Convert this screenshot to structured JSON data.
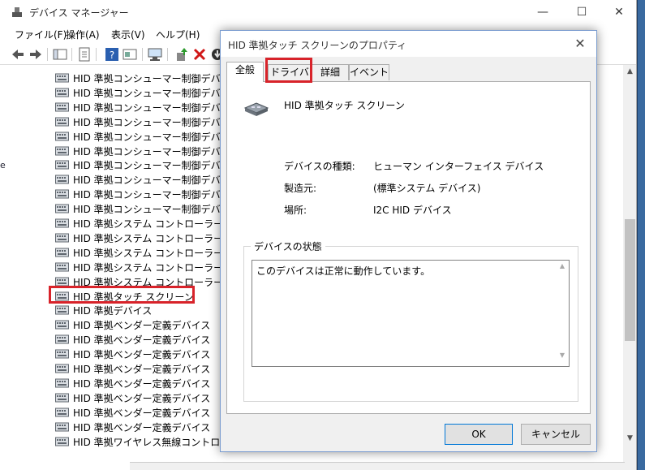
{
  "main_window": {
    "title": "デバイス マネージャー",
    "minimize_glyph": "—",
    "maximize_glyph": "☐",
    "close_glyph": "✕",
    "menu": [
      "ファイル(F)",
      "操作(A)",
      "表示(V)",
      "ヘルプ(H)"
    ],
    "left_edge_fragment": "e"
  },
  "device_tree": {
    "items": [
      "HID 準拠コンシューマー制御デバイス",
      "HID 準拠コンシューマー制御デバイス",
      "HID 準拠コンシューマー制御デバイス",
      "HID 準拠コンシューマー制御デバイス",
      "HID 準拠コンシューマー制御デバイス",
      "HID 準拠コンシューマー制御デバイス",
      "HID 準拠コンシューマー制御デバイス",
      "HID 準拠コンシューマー制御デバイス",
      "HID 準拠コンシューマー制御デバイス",
      "HID 準拠コンシューマー制御デバイス",
      "HID 準拠システム コントローラー",
      "HID 準拠システム コントローラー",
      "HID 準拠システム コントローラー",
      "HID 準拠システム コントローラー",
      "HID 準拠システム コントローラー",
      "HID 準拠タッチ スクリーン",
      "HID 準拠デバイス",
      "HID 準拠ベンダー定義デバイス",
      "HID 準拠ベンダー定義デバイス",
      "HID 準拠ベンダー定義デバイス",
      "HID 準拠ベンダー定義デバイス",
      "HID 準拠ベンダー定義デバイス",
      "HID 準拠ベンダー定義デバイス",
      "HID 準拠ベンダー定義デバイス",
      "HID 準拠ベンダー定義デバイス",
      "HID 準拠ワイヤレス無線コントロール"
    ]
  },
  "dialog": {
    "title": "HID 準拠タッチ スクリーンのプロパティ",
    "close_glyph": "✕",
    "tabs": [
      "全般",
      "ドライバー",
      "詳細",
      "イベント"
    ],
    "device_name": "HID 準拠タッチ スクリーン",
    "properties": {
      "type_label": "デバイスの種類:",
      "type_value": "ヒューマン インターフェイス デバイス",
      "manufacturer_label": "製造元:",
      "manufacturer_value": "(標準システム デバイス)",
      "location_label": "場所:",
      "location_value": "I2C HID デバイス"
    },
    "status_group_label": "デバイスの状態",
    "status_text": "このデバイスは正常に動作しています。",
    "ok_label": "OK",
    "cancel_label": "キャンセル"
  },
  "colors": {
    "highlight_red": "#d8232a",
    "dialog_border": "#7a9ccf"
  }
}
